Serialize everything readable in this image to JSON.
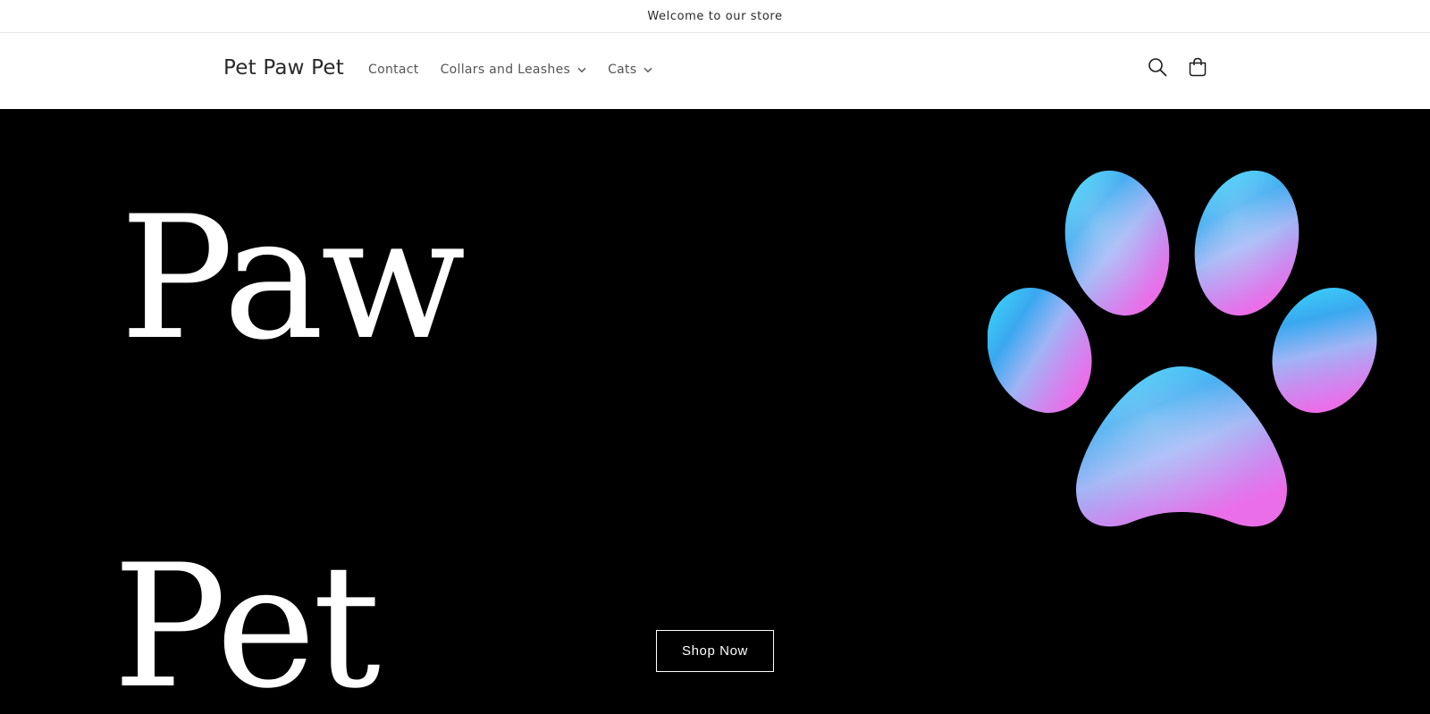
{
  "announcement": {
    "text": "Welcome to our store"
  },
  "header": {
    "logo": "Pet Paw Pet",
    "nav": [
      {
        "label": "Contact",
        "has_dropdown": false
      },
      {
        "label": "Collars and Leashes",
        "has_dropdown": true
      },
      {
        "label": "Cats",
        "has_dropdown": true
      }
    ],
    "icons": {
      "search": "search-icon",
      "cart": "cart-icon"
    }
  },
  "hero": {
    "heading_line_1": "Paw",
    "heading_line_2": "Pet",
    "button_label": "Shop Now",
    "image": "paw-print-gradient",
    "colors": {
      "background": "#000000",
      "text": "#ffffff",
      "paw_top": "#38d8f8",
      "paw_bottom": "#e879f0"
    }
  }
}
